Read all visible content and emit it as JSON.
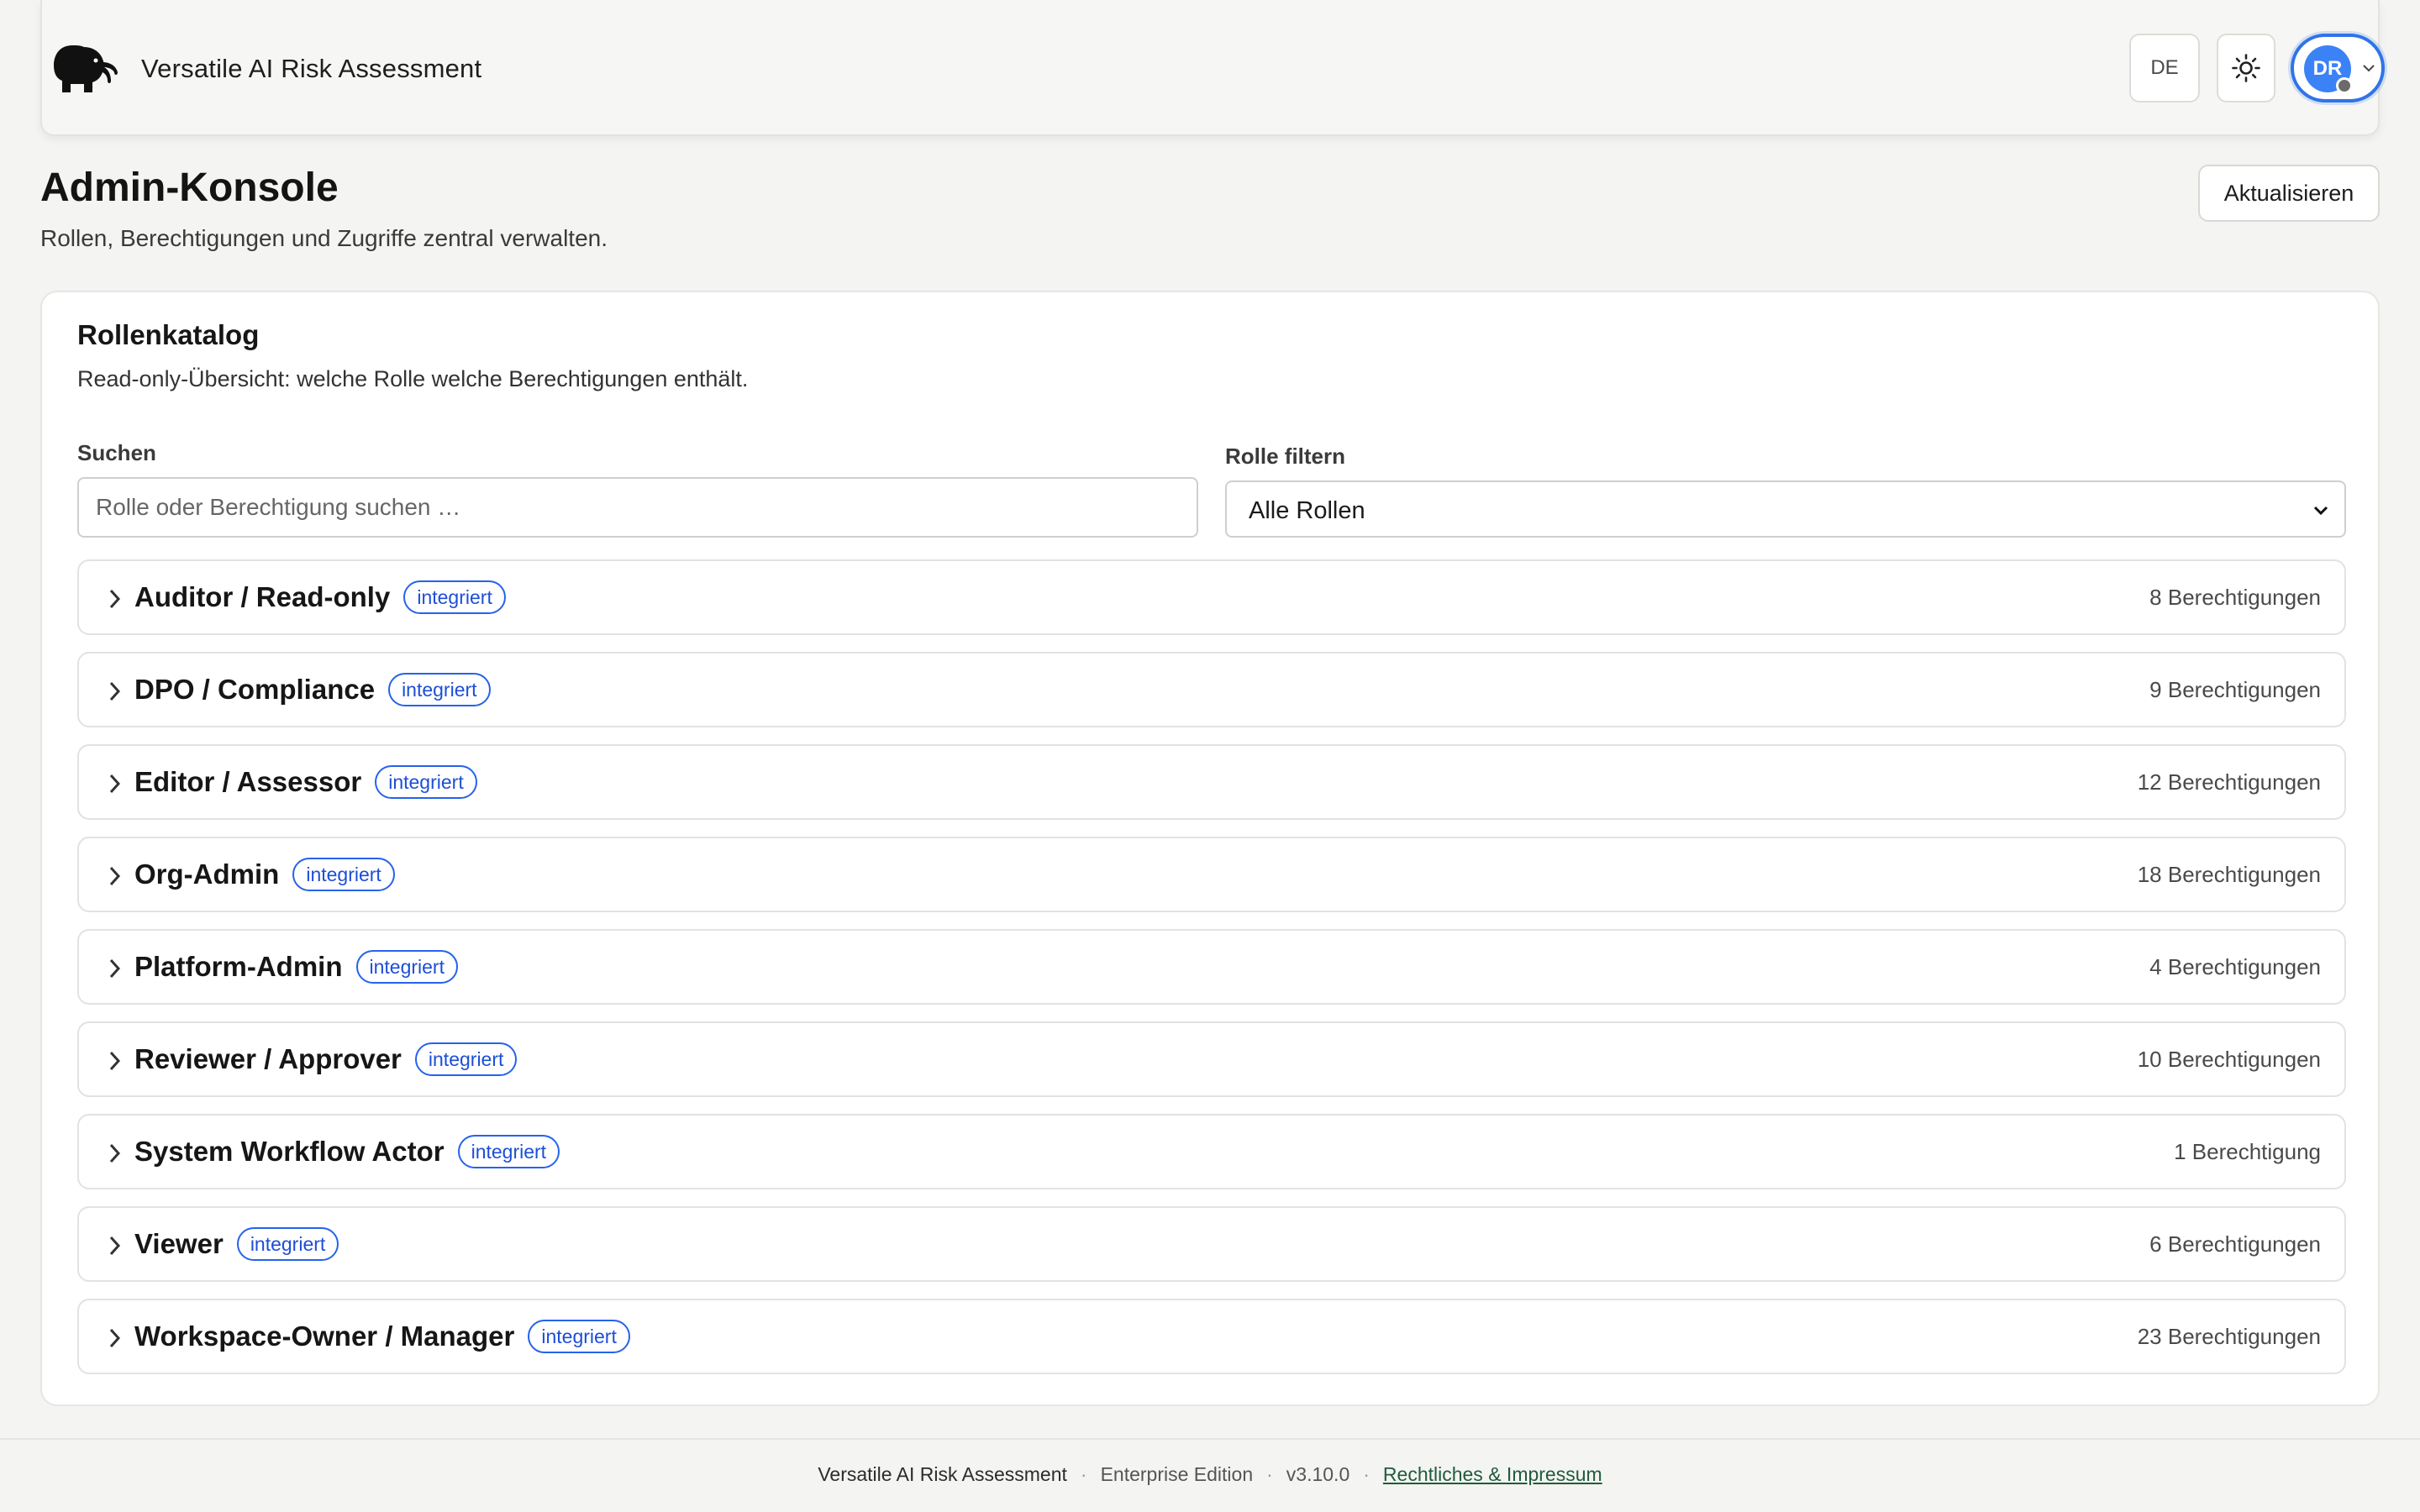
{
  "header": {
    "app_title": "Versatile AI Risk Assessment",
    "language": "DE",
    "theme_icon": "sun-icon",
    "user_initials": "DR"
  },
  "page": {
    "title": "Admin-Konsole",
    "subtitle": "Rollen, Berechtigungen und Zugriffe zentral verwalten.",
    "refresh_label": "Aktualisieren"
  },
  "catalog": {
    "title": "Rollenkatalog",
    "subtitle": "Read-only-Übersicht: welche Rolle welche Berechtigungen enthält.",
    "search_label": "Suchen",
    "search_placeholder": "Rolle oder Berechtigung suchen …",
    "filter_label": "Rolle filtern",
    "filter_value": "Alle Rollen",
    "roles": [
      {
        "name": "Auditor / Read-only",
        "badge": "integriert",
        "count": "8 Berechtigungen"
      },
      {
        "name": "DPO / Compliance",
        "badge": "integriert",
        "count": "9 Berechtigungen"
      },
      {
        "name": "Editor / Assessor",
        "badge": "integriert",
        "count": "12 Berechtigungen"
      },
      {
        "name": "Org-Admin",
        "badge": "integriert",
        "count": "18 Berechtigungen"
      },
      {
        "name": "Platform-Admin",
        "badge": "integriert",
        "count": "4 Berechtigungen"
      },
      {
        "name": "Reviewer / Approver",
        "badge": "integriert",
        "count": "10 Berechtigungen"
      },
      {
        "name": "System Workflow Actor",
        "badge": "integriert",
        "count": "1 Berechtigung"
      },
      {
        "name": "Viewer",
        "badge": "integriert",
        "count": "6 Berechtigungen"
      },
      {
        "name": "Workspace-Owner / Manager",
        "badge": "integriert",
        "count": "23 Berechtigungen"
      }
    ]
  },
  "footer": {
    "product": "Versatile AI Risk Assessment",
    "edition": "Enterprise Edition",
    "version": "v3.10.0",
    "legal_link": "Rechtliches & Impressum",
    "separator": "·"
  },
  "colors": {
    "accent": "#2f74e8",
    "badge": "#2563eb",
    "legal_link": "#1f5c3c"
  }
}
